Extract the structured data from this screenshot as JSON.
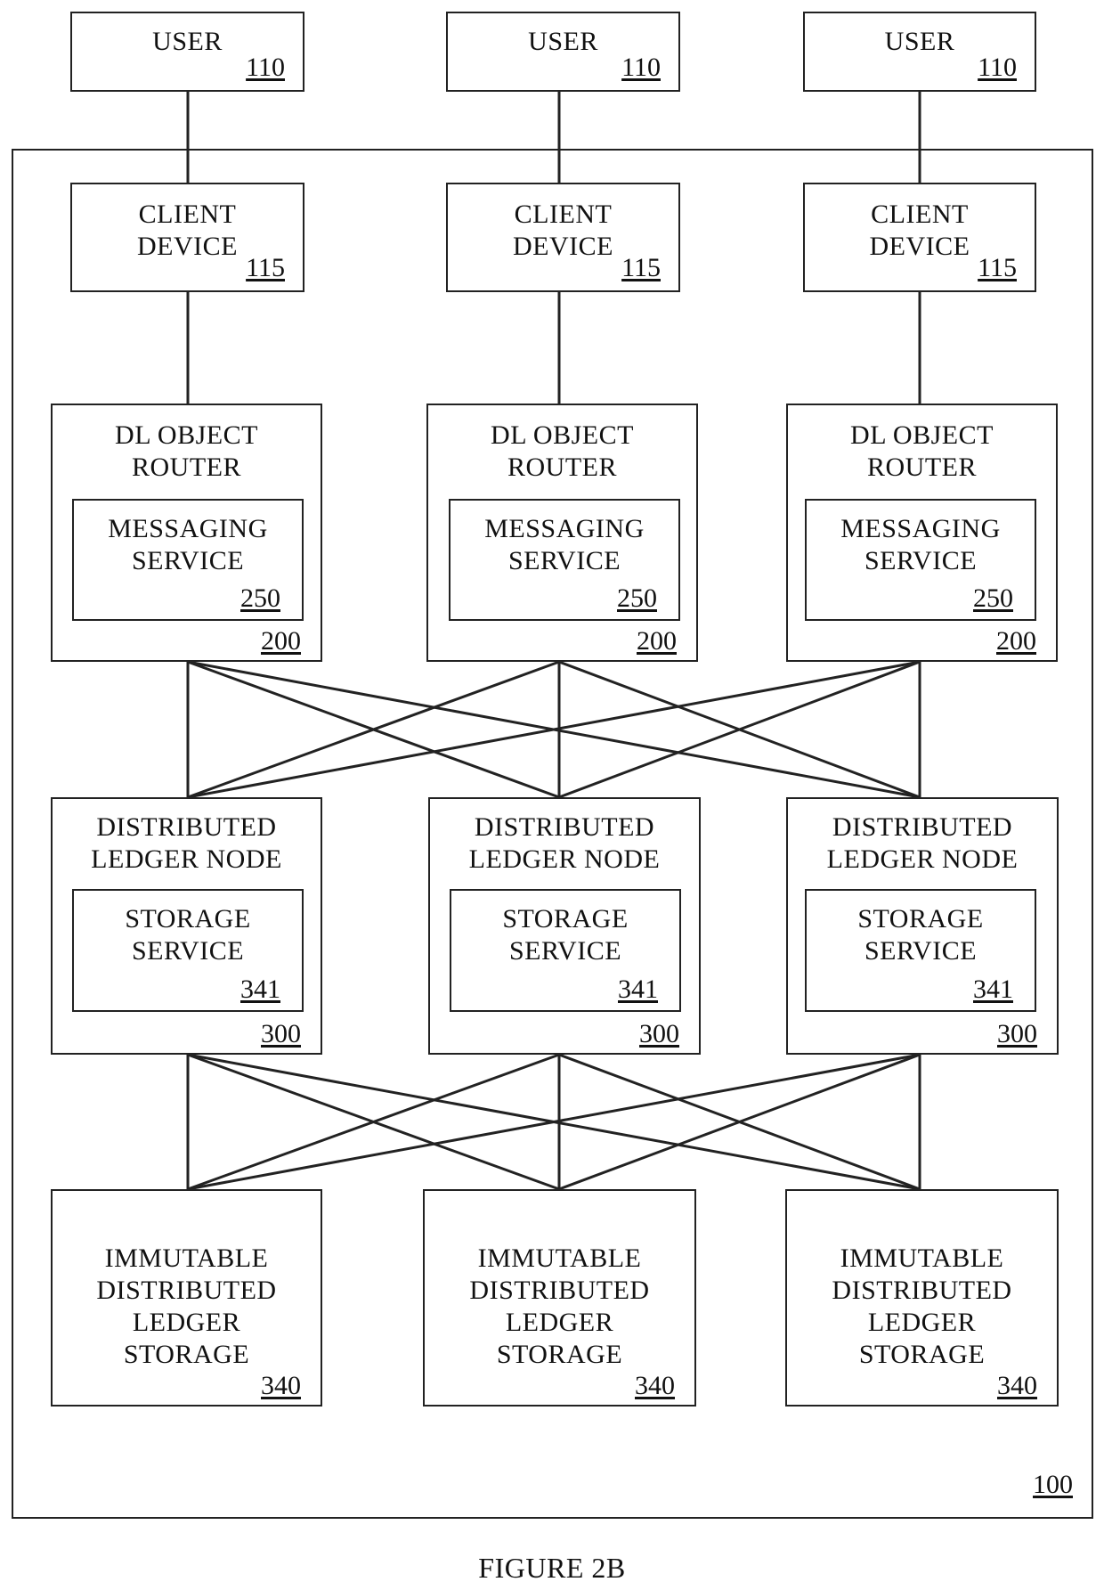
{
  "figure": {
    "caption": "FIGURE 2B",
    "system_ref": "100"
  },
  "columns": [
    {
      "user": {
        "label": "USER",
        "ref": "110"
      },
      "client": {
        "label_lines": [
          "CLIENT",
          "DEVICE"
        ],
        "ref": "115"
      },
      "router": {
        "label_lines": [
          "DL OBJECT",
          "ROUTER"
        ],
        "ref": "200",
        "service": {
          "label_lines": [
            "MESSAGING",
            "SERVICE"
          ],
          "ref": "250"
        }
      },
      "node": {
        "label_lines": [
          "DISTRIBUTED",
          "LEDGER NODE"
        ],
        "ref": "300",
        "service": {
          "label_lines": [
            "STORAGE",
            "SERVICE"
          ],
          "ref": "341"
        }
      },
      "storage": {
        "label_lines": [
          "IMMUTABLE",
          "DISTRIBUTED",
          "LEDGER",
          "STORAGE"
        ],
        "ref": "340"
      }
    },
    {
      "user": {
        "label": "USER",
        "ref": "110"
      },
      "client": {
        "label_lines": [
          "CLIENT",
          "DEVICE"
        ],
        "ref": "115"
      },
      "router": {
        "label_lines": [
          "DL OBJECT",
          "ROUTER"
        ],
        "ref": "200",
        "service": {
          "label_lines": [
            "MESSAGING",
            "SERVICE"
          ],
          "ref": "250"
        }
      },
      "node": {
        "label_lines": [
          "DISTRIBUTED",
          "LEDGER NODE"
        ],
        "ref": "300",
        "service": {
          "label_lines": [
            "STORAGE",
            "SERVICE"
          ],
          "ref": "341"
        }
      },
      "storage": {
        "label_lines": [
          "IMMUTABLE",
          "DISTRIBUTED",
          "LEDGER",
          "STORAGE"
        ],
        "ref": "340"
      }
    },
    {
      "user": {
        "label": "USER",
        "ref": "110"
      },
      "client": {
        "label_lines": [
          "CLIENT",
          "DEVICE"
        ],
        "ref": "115"
      },
      "router": {
        "label_lines": [
          "DL OBJECT",
          "ROUTER"
        ],
        "ref": "200",
        "service": {
          "label_lines": [
            "MESSAGING",
            "SERVICE"
          ],
          "ref": "250"
        }
      },
      "node": {
        "label_lines": [
          "DISTRIBUTED",
          "LEDGER NODE"
        ],
        "ref": "300",
        "service": {
          "label_lines": [
            "STORAGE",
            "SERVICE"
          ],
          "ref": "341"
        }
      },
      "storage": {
        "label_lines": [
          "IMMUTABLE",
          "DISTRIBUTED",
          "LEDGER",
          "STORAGE"
        ],
        "ref": "340"
      }
    }
  ],
  "connections": {
    "user_to_client": "one-to-one",
    "client_to_router": "one-to-one",
    "router_to_node": "all-to-all",
    "node_to_storage": "all-to-all"
  }
}
